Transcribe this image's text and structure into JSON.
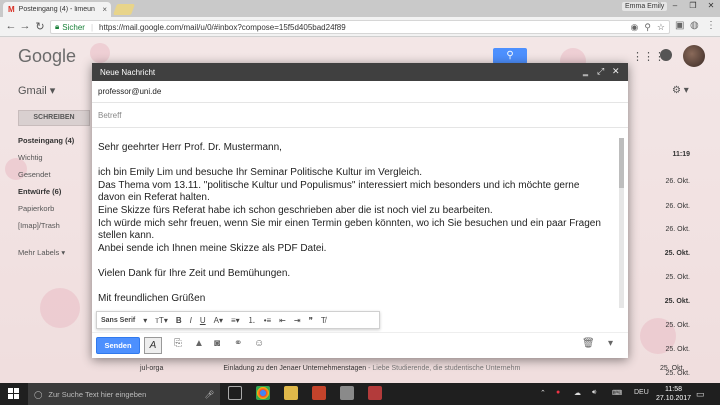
{
  "browser": {
    "tab_title": "Posteingang (4) - limeun",
    "tab_close": "×",
    "gmail_mark": "M",
    "user_badge": "Emma Emily",
    "secure_label": "Sicher",
    "url": "https://mail.google.com/mail/u/0/#inbox?compose=15f5d405bad24f89"
  },
  "gmail": {
    "logo": "Google",
    "app_label": "Gmail ▾",
    "compose_side_label": "SCHREIBEN",
    "nav": [
      {
        "label": "Posteingang (4)",
        "bold": true
      },
      {
        "label": "Wichtig",
        "bold": false
      },
      {
        "label": "Gesendet",
        "bold": false
      },
      {
        "label": "Entwürfe (6)",
        "bold": true
      },
      {
        "label": "Papierkorb",
        "bold": false
      },
      {
        "label": "[Imap]/Trash",
        "bold": false
      }
    ],
    "more_labels": "Mehr Labels ▾",
    "list_dates": [
      "11:19",
      "26. Okt.",
      "26. Okt.",
      "26. Okt.",
      "25. Okt.",
      "25. Okt.",
      "25. Okt.",
      "25. Okt.",
      "25. Okt.",
      "25. Okt."
    ],
    "bottom_row": {
      "sender": "jul-orga",
      "subject": "Einladung zu den Jenaer Unternehmenstagen",
      "snippet": "- Liebe Studierende, die studentische Unternehm",
      "date": "25. Okt."
    }
  },
  "compose": {
    "title": "Neue Nachricht",
    "to": "professor@uni.de",
    "subject_placeholder": "Betreff",
    "body": [
      "Sehr geehrter Herr Prof. Dr. Mustermann,",
      "",
      "ich bin Emily Lim und besuche Ihr Seminar Politische Kultur im Vergleich.",
      "Das Thema vom 13.11. \"politische Kultur und Populismus\" interessiert mich besonders und ich möchte gerne davon ein Referat halten.",
      "Eine Skizze fürs Referat habe ich schon geschrieben aber die ist noch viel zu bearbeiten.",
      "Ich würde mich sehr freuen, wenn Sie mir einen Termin geben könnten, wo ich Sie besuchen und ein paar Fragen stellen kann.",
      "Anbei sende ich Ihnen meine Skizze als PDF Datei.",
      "",
      "Vielen Dank für Ihre Zeit und Bemühungen.",
      "",
      "Mit freundlichen Grüßen"
    ],
    "font_name": "Sans Serif",
    "send_label": "Senden"
  },
  "taskbar": {
    "search_placeholder": "Zur Suche Text hier eingeben",
    "lang": "DEU",
    "time": "11:58",
    "date": "27.10.2017"
  }
}
